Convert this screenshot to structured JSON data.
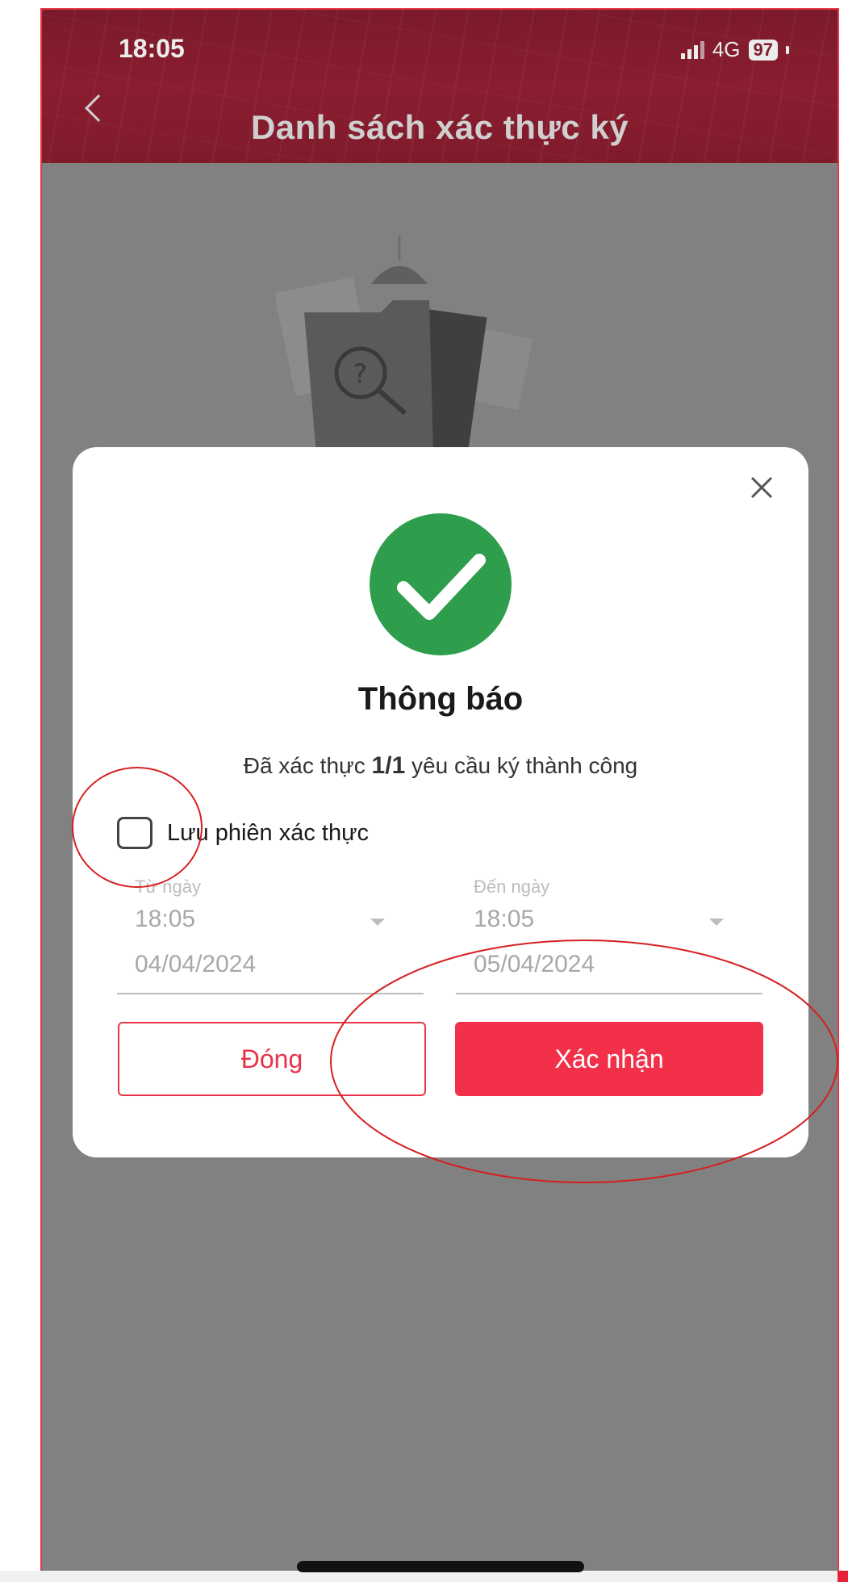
{
  "status_bar": {
    "time": "18:05",
    "network": "4G",
    "battery": "97"
  },
  "header": {
    "title": "Danh sách xác thực ký"
  },
  "modal": {
    "title": "Thông báo",
    "message_prefix": "Đã xác thực ",
    "message_count": "1/1",
    "message_suffix": " yêu cầu ký thành công",
    "checkbox_label": "Lưu phiên xác thực",
    "checkbox_checked": false,
    "from": {
      "label": "Từ ngày",
      "time": "18:05",
      "date": "04/04/2024"
    },
    "to": {
      "label": "Đến ngày",
      "time": "18:05",
      "date": "05/04/2024"
    },
    "close_label": "Đóng",
    "confirm_label": "Xác nhận"
  },
  "colors": {
    "accent": "#f2304a",
    "success": "#2e9e4d",
    "header": "#8a1d30",
    "annotation": "#d61f1f"
  },
  "icons": {
    "back": "chevron-left-icon",
    "close": "close-icon",
    "success": "check-circle-icon"
  }
}
